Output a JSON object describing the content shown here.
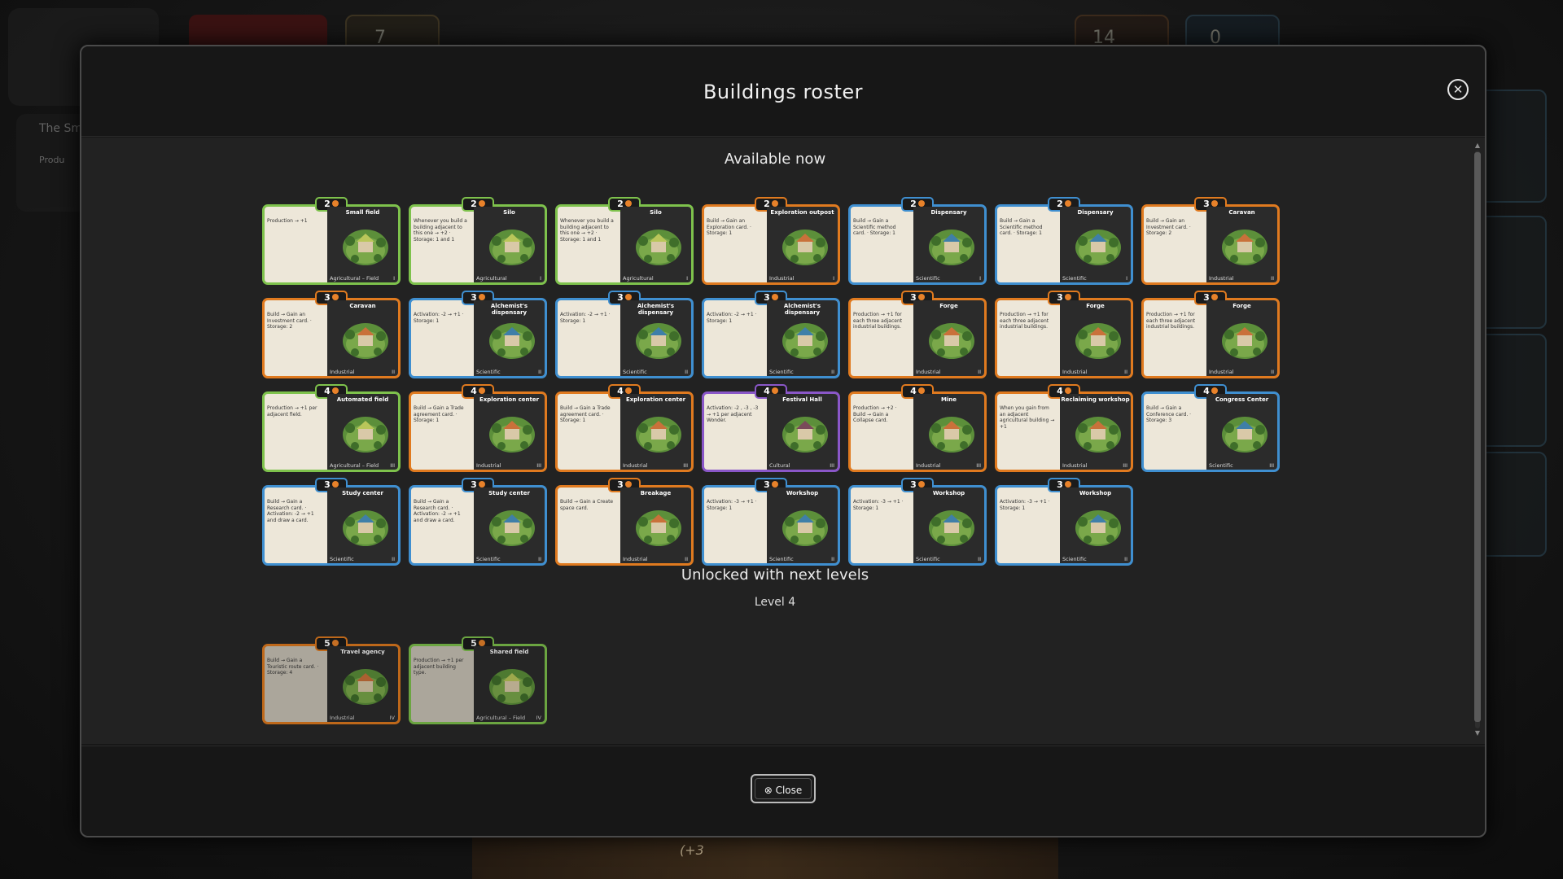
{
  "background": {
    "left_panel_title": "The Sm",
    "left_panel_label": "Produ",
    "bottom_text": "(+3",
    "top_counter_a": "7",
    "top_counter_b": "14",
    "top_counter_c": "0"
  },
  "modal": {
    "title": "Buildings roster",
    "close_icon": "close-circle-icon",
    "close_button_label": "Close",
    "sections": {
      "available_title": "Available now",
      "unlocked_title": "Unlocked with next levels",
      "level_label": "Level 4"
    }
  },
  "colors": {
    "agricultural": "#7ec24c",
    "industrial": "#e07a1f",
    "scientific": "#3f8fd0",
    "cultural": "#8a57c8"
  },
  "available_cards": [
    {
      "cost": "2",
      "name": "Small field",
      "text": "Production → +1",
      "type": "Agricultural – Field",
      "tier": "I",
      "category": "agri"
    },
    {
      "cost": "2",
      "name": "Silo",
      "text": "Whenever you build a building adjacent to this one → +2 · Storage: 1 and 1",
      "type": "Agricultural",
      "tier": "I",
      "category": "agri"
    },
    {
      "cost": "2",
      "name": "Silo",
      "text": "Whenever you build a building adjacent to this one → +2 · Storage: 1 and 1",
      "type": "Agricultural",
      "tier": "I",
      "category": "agri"
    },
    {
      "cost": "2",
      "name": "Exploration outpost",
      "text": "Build → Gain an Exploration card. · Storage: 1",
      "type": "Industrial",
      "tier": "I",
      "category": "ind"
    },
    {
      "cost": "2",
      "name": "Dispensary",
      "text": "Build → Gain a Scientific method card. · Storage: 1",
      "type": "Scientific",
      "tier": "I",
      "category": "sci"
    },
    {
      "cost": "2",
      "name": "Dispensary",
      "text": "Build → Gain a Scientific method card. · Storage: 1",
      "type": "Scientific",
      "tier": "I",
      "category": "sci"
    },
    {
      "cost": "3",
      "name": "Caravan",
      "text": "Build → Gain an Investment card. · Storage: 2",
      "type": "Industrial",
      "tier": "II",
      "category": "ind"
    },
    {
      "cost": "3",
      "name": "Caravan",
      "text": "Build → Gain an Investment card. · Storage: 2",
      "type": "Industrial",
      "tier": "II",
      "category": "ind"
    },
    {
      "cost": "3",
      "name": "Alchemist's dispensary",
      "text": "Activation: -2 → +1 · Storage: 1",
      "type": "Scientific",
      "tier": "II",
      "category": "sci"
    },
    {
      "cost": "3",
      "name": "Alchemist's dispensary",
      "text": "Activation: -2 → +1 · Storage: 1",
      "type": "Scientific",
      "tier": "II",
      "category": "sci"
    },
    {
      "cost": "3",
      "name": "Alchemist's dispensary",
      "text": "Activation: -2 → +1 · Storage: 1",
      "type": "Scientific",
      "tier": "II",
      "category": "sci"
    },
    {
      "cost": "3",
      "name": "Forge",
      "text": "Production → +1 for each three adjacent industrial buildings.",
      "type": "Industrial",
      "tier": "II",
      "category": "ind"
    },
    {
      "cost": "3",
      "name": "Forge",
      "text": "Production → +1 for each three adjacent industrial buildings.",
      "type": "Industrial",
      "tier": "II",
      "category": "ind"
    },
    {
      "cost": "3",
      "name": "Forge",
      "text": "Production → +1 for each three adjacent industrial buildings.",
      "type": "Industrial",
      "tier": "II",
      "category": "ind"
    },
    {
      "cost": "4",
      "name": "Automated field",
      "text": "Production → +1 per adjacent field.",
      "type": "Agricultural – Field",
      "tier": "III",
      "category": "agri"
    },
    {
      "cost": "4",
      "name": "Exploration center",
      "text": "Build → Gain a Trade agreement card. · Storage: 1",
      "type": "Industrial",
      "tier": "III",
      "category": "ind"
    },
    {
      "cost": "4",
      "name": "Exploration center",
      "text": "Build → Gain a Trade agreement card. · Storage: 1",
      "type": "Industrial",
      "tier": "III",
      "category": "ind"
    },
    {
      "cost": "4",
      "name": "Festival Hall",
      "text": "Activation: -2 , -3 , -3 → +1 per adjacent Wonder.",
      "type": "Cultural",
      "tier": "III",
      "category": "cul"
    },
    {
      "cost": "4",
      "name": "Mine",
      "text": "Production → +2 · Build → Gain a Collapse card.",
      "type": "Industrial",
      "tier": "III",
      "category": "ind"
    },
    {
      "cost": "4",
      "name": "Reclaiming workshop",
      "text": "When you gain from an adjacent agricultural building → +1",
      "type": "Industrial",
      "tier": "III",
      "category": "ind"
    },
    {
      "cost": "4",
      "name": "Congress Center",
      "text": "Build → Gain a Conference card. · Storage: 3",
      "type": "Scientific",
      "tier": "III",
      "category": "sci"
    },
    {
      "cost": "3",
      "name": "Study center",
      "text": "Build → Gain a Research card. · Activation: -2 → +1 and draw a card.",
      "type": "Scientific",
      "tier": "II",
      "category": "sci"
    },
    {
      "cost": "3",
      "name": "Study center",
      "text": "Build → Gain a Research card. · Activation: -2 → +1 and draw a card.",
      "type": "Scientific",
      "tier": "II",
      "category": "sci"
    },
    {
      "cost": "3",
      "name": "Breakage",
      "text": "Build → Gain a Create space card.",
      "type": "Industrial",
      "tier": "II",
      "category": "ind"
    },
    {
      "cost": "3",
      "name": "Workshop",
      "text": "Activation: -3 → +1 · Storage: 1",
      "type": "Scientific",
      "tier": "II",
      "category": "sci"
    },
    {
      "cost": "3",
      "name": "Workshop",
      "text": "Activation: -3 → +1 · Storage: 1",
      "type": "Scientific",
      "tier": "II",
      "category": "sci"
    },
    {
      "cost": "3",
      "name": "Workshop",
      "text": "Activation: -3 → +1 · Storage: 1",
      "type": "Scientific",
      "tier": "II",
      "category": "sci"
    }
  ],
  "locked_cards": [
    {
      "cost": "5",
      "name": "Travel agency",
      "text": "Build → Gain a Touristic route card. · Storage: 4",
      "type": "Industrial",
      "tier": "IV",
      "category": "ind"
    },
    {
      "cost": "5",
      "name": "Shared field",
      "text": "Production → +1 per adjacent building type.",
      "type": "Agricultural – Field",
      "tier": "IV",
      "category": "agri"
    }
  ]
}
